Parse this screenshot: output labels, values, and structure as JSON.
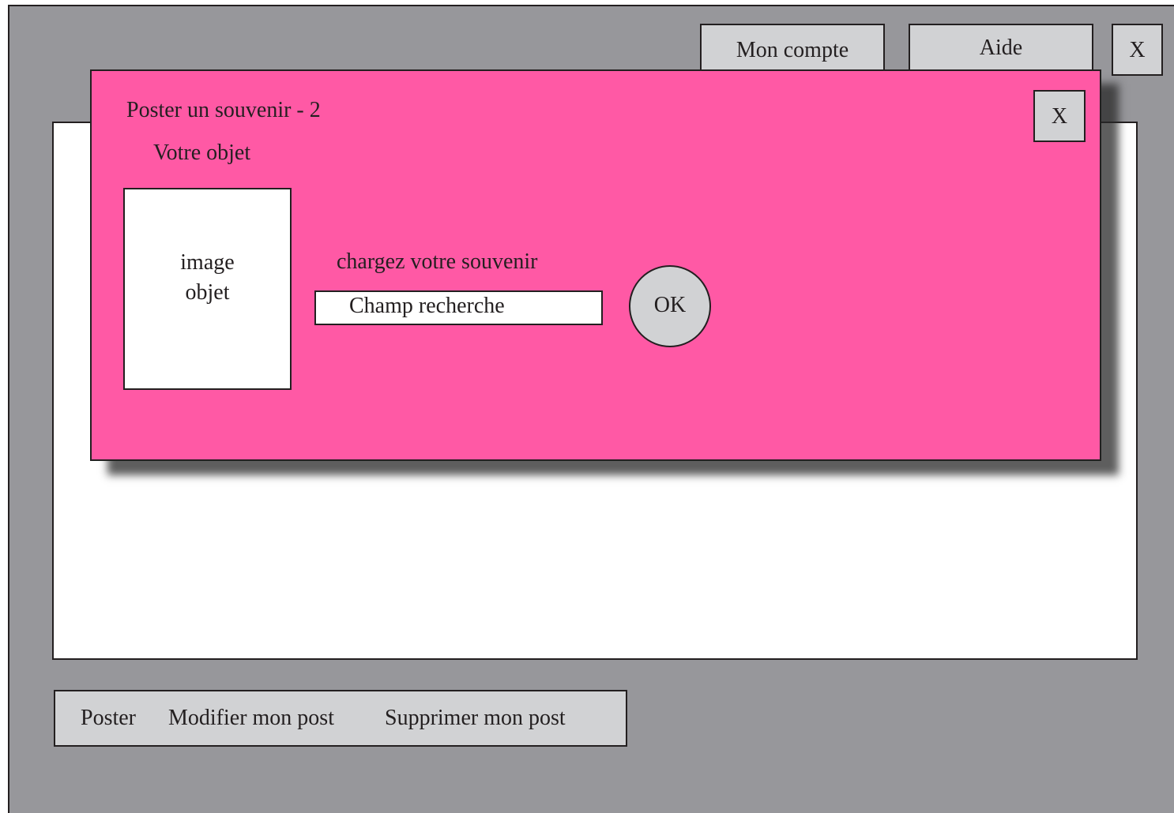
{
  "header": {
    "account_label": "Mon compte",
    "help_label": "Aide",
    "close_label": "X"
  },
  "actions": {
    "post_label": "Poster",
    "edit_label": "Modifier mon post",
    "delete_label": "Supprimer mon post"
  },
  "modal": {
    "title": "Poster un souvenir - 2",
    "close_label": "X",
    "object_label": "Votre objet",
    "image_placeholder_line1": "image",
    "image_placeholder_line2": "objet",
    "upload_label": "chargez votre souvenir",
    "search_field_value": "Champ recherche",
    "ok_label": "OK"
  },
  "colors": {
    "background": "#97979b",
    "modal": "#ff59a5",
    "button": "#d1d2d4",
    "panel": "#ffffff",
    "border": "#231f20"
  }
}
